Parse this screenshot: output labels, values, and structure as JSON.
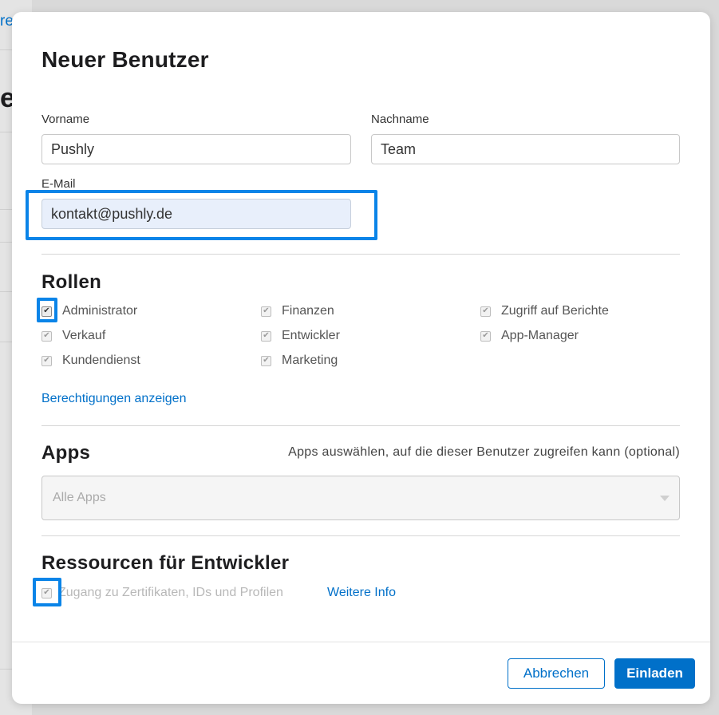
{
  "background": {
    "link_fragment": "re",
    "heading_fragment": "e"
  },
  "modal": {
    "title": "Neuer Benutzer",
    "fields": {
      "first_name": {
        "label": "Vorname",
        "value": "Pushly"
      },
      "last_name": {
        "label": "Nachname",
        "value": "Team"
      },
      "email": {
        "label": "E-Mail",
        "value": "kontakt@pushly.de"
      }
    },
    "roles": {
      "heading": "Rollen",
      "items": [
        {
          "label": "Administrator",
          "checked": true
        },
        {
          "label": "Verkauf",
          "checked": true
        },
        {
          "label": "Kundendienst",
          "checked": true
        },
        {
          "label": "Finanzen",
          "checked": true
        },
        {
          "label": "Entwickler",
          "checked": true
        },
        {
          "label": "Marketing",
          "checked": true
        },
        {
          "label": "Zugriff auf Berichte",
          "checked": true
        },
        {
          "label": "App-Manager",
          "checked": true
        }
      ],
      "permissions_link": "Berechtigungen anzeigen"
    },
    "apps": {
      "heading": "Apps",
      "hint": "Apps auswählen, auf die dieser Benutzer zugreifen kann (optional)",
      "select_value": "Alle Apps"
    },
    "developer_resources": {
      "heading": "Ressourcen für Entwickler",
      "checkbox_label": "Zugang zu Zertifikaten, IDs und Profilen",
      "more_info_link": "Weitere Info"
    },
    "buttons": {
      "cancel": "Abbrechen",
      "invite": "Einladen"
    }
  },
  "colors": {
    "accent": "#0070c9",
    "highlight": "#0a84e8"
  }
}
